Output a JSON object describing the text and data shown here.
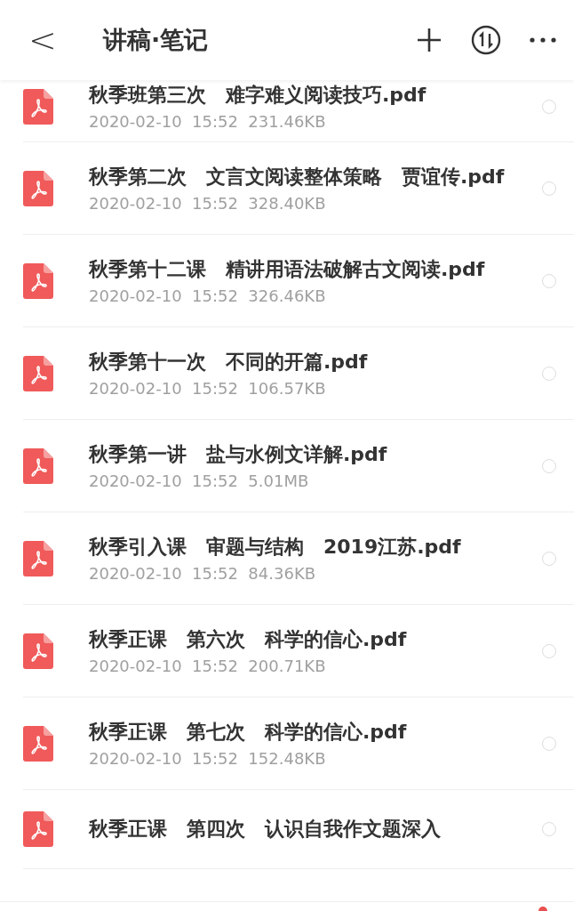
{
  "header": {
    "back": "<",
    "title": "讲稿·笔记"
  },
  "files": [
    {
      "name": "秋季班第三次　难字难义阅读技巧.pdf",
      "date": "2020-02-10",
      "time": "15:52",
      "size": "231.46KB",
      "selected": false
    },
    {
      "name": "秋季第二次　文言文阅读整体策略　贾谊传.pdf",
      "date": "2020-02-10",
      "time": "15:52",
      "size": "328.40KB",
      "selected": false
    },
    {
      "name": "秋季第十二课　精讲用语法破解古文阅读.pdf",
      "date": "2020-02-10",
      "time": "15:52",
      "size": "326.46KB",
      "selected": false
    },
    {
      "name": "秋季第十一次　不同的开篇.pdf",
      "date": "2020-02-10",
      "time": "15:52",
      "size": "106.57KB",
      "selected": false
    },
    {
      "name": "秋季第一讲　盐与水例文详解.pdf",
      "date": "2020-02-10",
      "time": "15:52",
      "size": "5.01MB",
      "selected": false
    },
    {
      "name": "秋季引入课　审题与结构　2019江苏.pdf",
      "date": "2020-02-10",
      "time": "15:52",
      "size": "84.36KB",
      "selected": false
    },
    {
      "name": "秋季正课　第六次　科学的信心.pdf",
      "date": "2020-02-10",
      "time": "15:52",
      "size": "200.71KB",
      "selected": false
    },
    {
      "name": "秋季正课　第七次　科学的信心.pdf",
      "date": "2020-02-10",
      "time": "15:52",
      "size": "152.48KB",
      "selected": false
    },
    {
      "name": "秋季正课　第四次　认识自我作文题深入",
      "selected": false
    }
  ]
}
